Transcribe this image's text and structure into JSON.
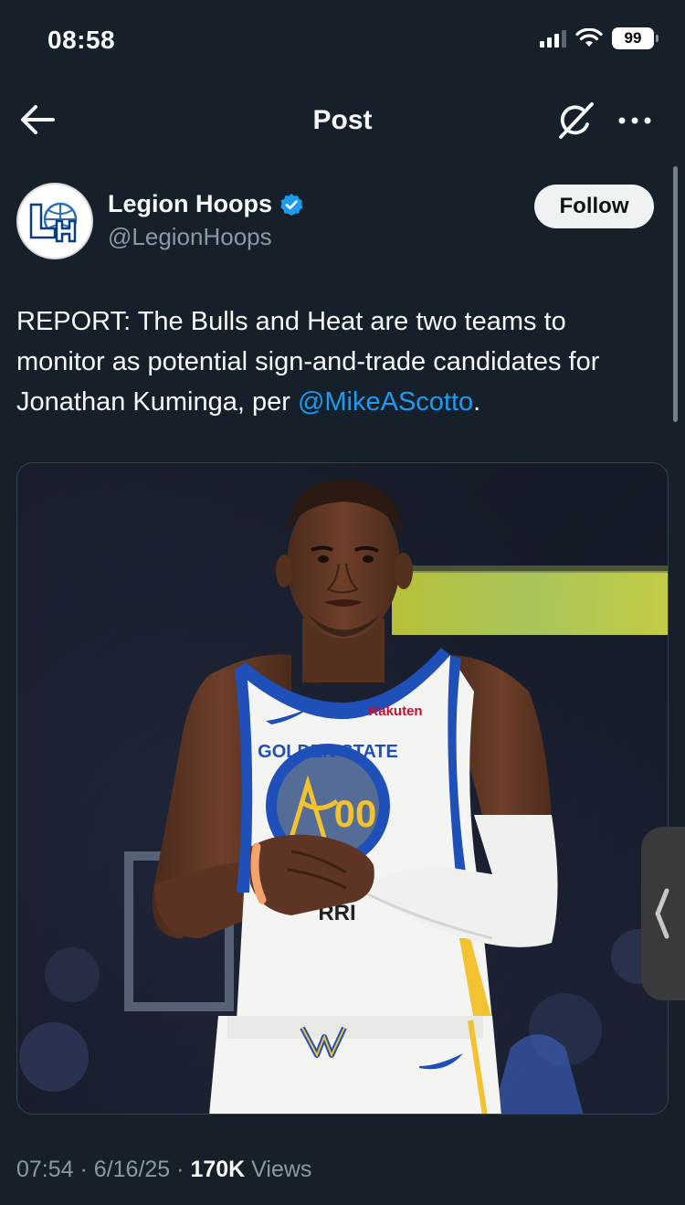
{
  "status_bar": {
    "time": "08:58",
    "battery": "99",
    "icons": [
      "cellular-signal-icon",
      "wifi-icon",
      "battery-icon"
    ]
  },
  "nav": {
    "title": "Post",
    "icons": [
      "back-arrow-icon",
      "grok-icon",
      "more-icon"
    ]
  },
  "author": {
    "name": "Legion Hoops",
    "handle": "@LegionHoops",
    "verified": true,
    "follow_label": "Follow",
    "avatar_initials": "LH"
  },
  "post": {
    "text_before": "REPORT: The Bulls and Heat are two teams to monitor as potential sign-and-trade candidates for Jonathan Kuminga, per ",
    "mention": "@MikeAScotto",
    "text_after": "."
  },
  "media": {
    "jersey_team": "GOLDEN STATE",
    "jersey_number": "00",
    "jersey_sponsor": "Rakuten",
    "jersey_partial": "RRI"
  },
  "meta": {
    "time": "07:54",
    "separator": "·",
    "date": "6/16/25",
    "views_count": "170K",
    "views_label": "Views"
  },
  "colors": {
    "background": "#15202b",
    "link": "#1d9bf0",
    "secondary_text": "#8b98a5",
    "verified": "#1d9bf0"
  }
}
